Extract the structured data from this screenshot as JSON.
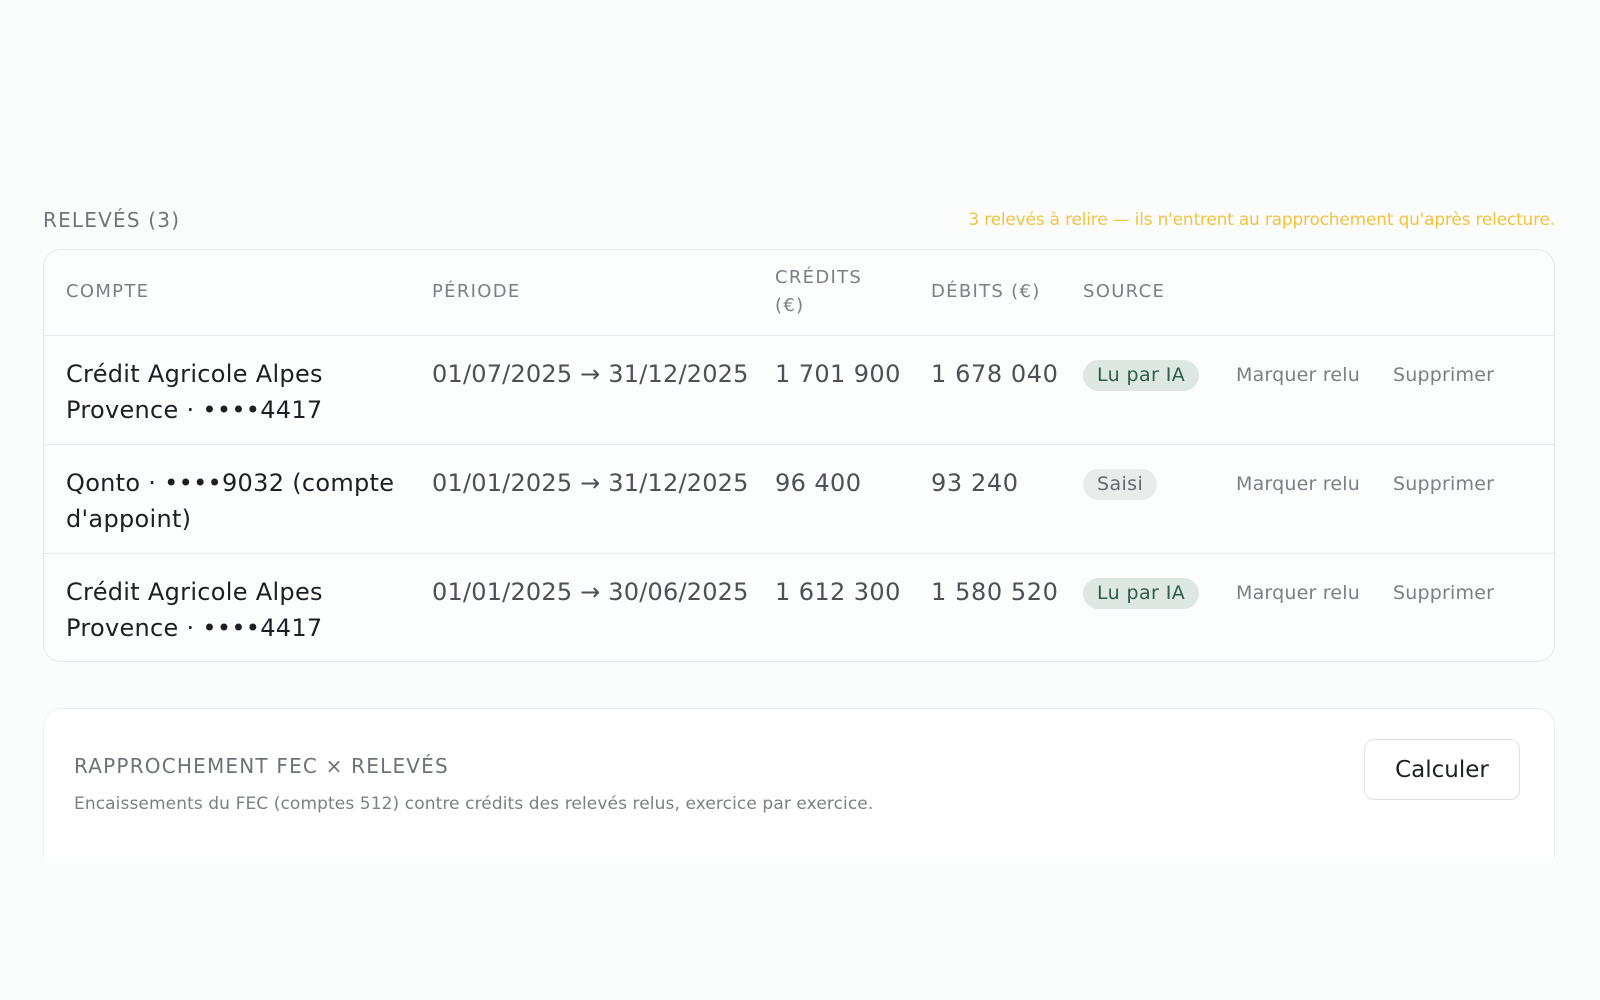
{
  "statements": {
    "section_title": "RELEVÉS (3)",
    "warning": "3 relevés à relire — ils n'entrent au rapprochement qu'après relecture.",
    "columns": {
      "account": "COMPTE",
      "period": "PÉRIODE",
      "credits": "CRÉDITS (€)",
      "debits": "DÉBITS (€)",
      "source": "SOURCE"
    },
    "rows": [
      {
        "account": "Crédit Agricole Alpes Provence · ••••4417",
        "period": "01/07/2025 → 31/12/2025",
        "credits": "1 701 900",
        "debits": "1 678 040",
        "source": "Lu par IA",
        "mark_label": "Marquer relu",
        "delete_label": "Supprimer"
      },
      {
        "account": "Qonto · ••••9032 (compte d'appoint)",
        "period": "01/01/2025 → 31/12/2025",
        "credits": "96 400",
        "debits": "93 240",
        "source": "Saisi",
        "mark_label": "Marquer relu",
        "delete_label": "Supprimer"
      },
      {
        "account": "Crédit Agricole Alpes Provence · ••••4417",
        "period": "01/01/2025 → 30/06/2025",
        "credits": "1 612 300",
        "debits": "1 580 520",
        "source": "Lu par IA",
        "mark_label": "Marquer relu",
        "delete_label": "Supprimer"
      }
    ]
  },
  "reconciliation": {
    "title": "RAPPROCHEMENT FEC × RELEVÉS",
    "description": "Encaissements du FEC (comptes 512) contre crédits des relevés relus, exercice par exercice.",
    "button_label": "Calculer"
  },
  "colors": {
    "warning": "#f2c33d",
    "badge_ai_bg": "#dde8e3",
    "badge_ai_text": "#2c5c4b",
    "badge_manual_bg": "#eaeceb"
  }
}
